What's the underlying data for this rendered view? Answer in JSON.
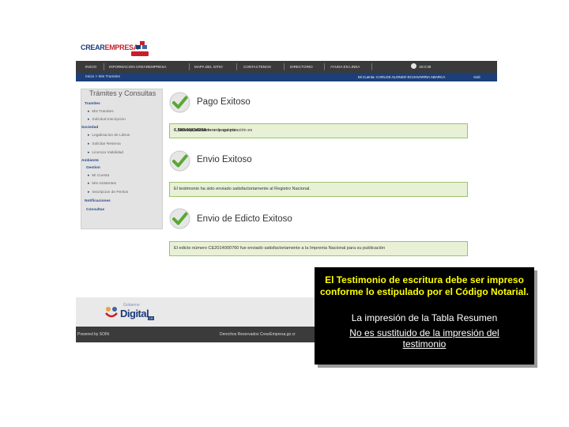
{
  "header": {
    "logo_text_1": "CREAR",
    "logo_text_2": "EMPRESA",
    "brand_colors": {
      "navy": "#1d3c78",
      "red": "#c8202b"
    }
  },
  "nav": {
    "items": [
      {
        "label": "Inicio"
      },
      {
        "label": "Informacion CrearEmpresa"
      },
      {
        "label": "Mapa del sitio"
      },
      {
        "label": "Contactenos"
      },
      {
        "label": "Directorio"
      },
      {
        "label": "Ayuda en linea"
      }
    ],
    "time": "15:0:39"
  },
  "subbar": {
    "breadcrumb": "Inicio > Mis Tramites",
    "account": "Mi Cuenta: CARLOS ALONSO ECHAVARRIA ABARCA",
    "exit": "Salir"
  },
  "sidebar": {
    "title": "Trámites y Consultas",
    "lines": [
      {
        "text": "Tramites",
        "kind": "section"
      },
      {
        "text": "Mis Tramites",
        "kind": "item"
      },
      {
        "text": "Solicitud Inscripcion",
        "kind": "item"
      },
      {
        "text": "Sociedad",
        "kind": "section"
      },
      {
        "text": "Legalizacion de Libros",
        "kind": "item"
      },
      {
        "text": "Solicitar Reserva",
        "kind": "item"
      },
      {
        "text": "Licencia Viabilidad",
        "kind": "item"
      },
      {
        "text": "Ambiente",
        "kind": "section"
      },
      {
        "text": "Gestion",
        "kind": "sub"
      },
      {
        "text": "Mi Cuenta",
        "kind": "item"
      },
      {
        "text": "Mis Asistentes",
        "kind": "item"
      },
      {
        "text": "Inscripcion de Peritos",
        "kind": "item"
      },
      {
        "text": "Notificaciones",
        "kind": "section"
      },
      {
        "text": "Consultas",
        "kind": "sub"
      }
    ]
  },
  "results": [
    {
      "title": "Pago Exitoso",
      "message_pre": "Se ha procesado un pago por ",
      "amount": "6,580.00",
      "message_mid": " colones, el número de autorización es ",
      "auth_number": "234234"
    },
    {
      "title": "Envio Exitoso",
      "message": "El testimonio ha sido enviado satisfactoriamente al Registro Nacional."
    },
    {
      "title": "Envio de Edicto Exitoso",
      "message": "El edicto número CE2014000760 fue enviado satisfactoriamente a la Imprenta Nacional para su publicación"
    }
  ],
  "footer": {
    "gob_top": "Gobierno",
    "gob_main": "Digital",
    "gob_cr": "CR",
    "powered": "Powered by SOIN",
    "rights": "Derechos Reservados CrearEmpresa.go.cr"
  },
  "note": {
    "line1": "El Testimonio de escritura debe  ser impreso",
    "line2": "conforme lo estipulado por el Código Notarial.",
    "line3": "La impresión de la Tabla Resumen",
    "line4": "No es sustituido  de la impresión del",
    "line5": "testimonio"
  },
  "colors": {
    "success_bg": "#e8f1d6",
    "success_border": "#9cc36a",
    "check_green": "#5aa832",
    "note_text": "#ffff00"
  }
}
